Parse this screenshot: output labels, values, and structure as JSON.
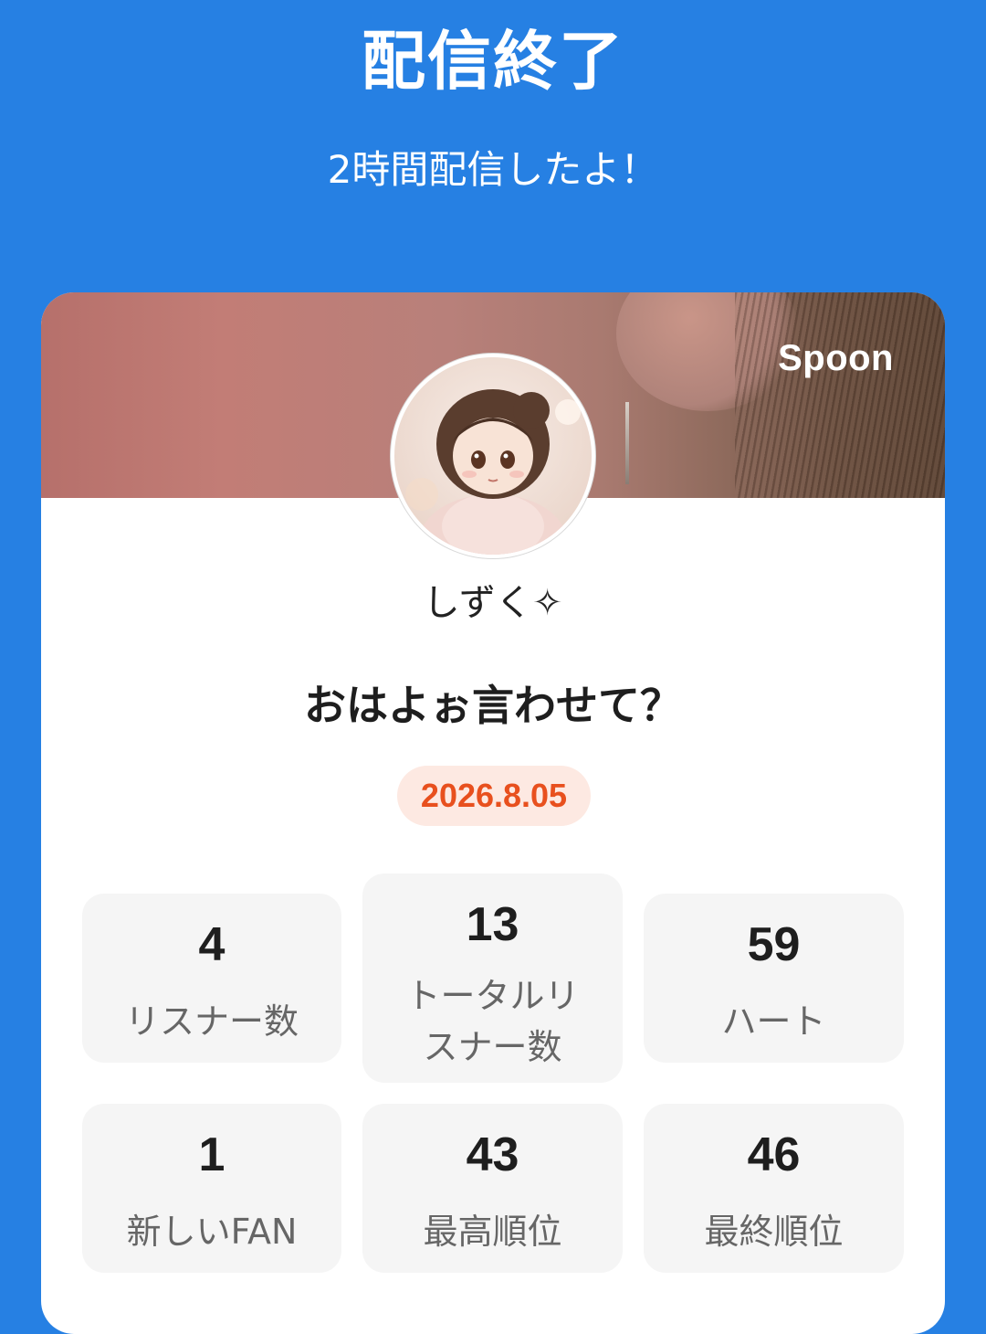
{
  "header": {
    "title": "配信終了",
    "subtitle": "2時間配信したよ！"
  },
  "card": {
    "brand": "Spoon",
    "username": "しずく✧",
    "stream_title": "おはよぉ言わせて？",
    "date": "2026.8.05"
  },
  "stats": [
    {
      "value": "4",
      "label": "リスナー数"
    },
    {
      "value": "13",
      "label": "トータルリスナー数"
    },
    {
      "value": "59",
      "label": "ハート"
    },
    {
      "value": "1",
      "label": "新しいFAN"
    },
    {
      "value": "43",
      "label": "最高順位"
    },
    {
      "value": "46",
      "label": "最終順位"
    }
  ],
  "colors": {
    "background": "#2680e3",
    "date_badge_text": "#e8501e",
    "date_badge_bg": "#fde9e2"
  }
}
